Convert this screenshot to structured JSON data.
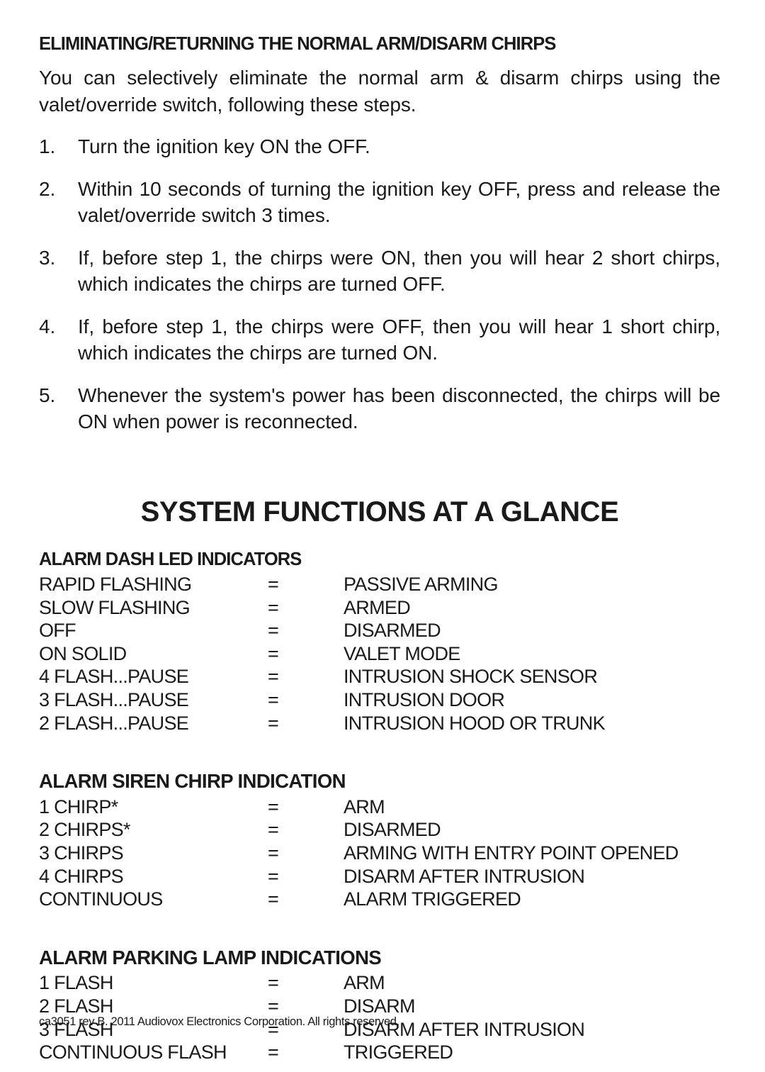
{
  "section1": {
    "heading": "ELIMINATING/RETURNING THE NORMAL ARM/DISARM CHIRPS",
    "intro": "You can selectively eliminate the normal arm & disarm chirps using the valet/override switch, following these steps.",
    "steps": [
      {
        "num": "1.",
        "text": "Turn the ignition key ON the OFF."
      },
      {
        "num": "2.",
        "text": "Within 10 seconds of turning the ignition key OFF, press and release the valet/override switch 3 times."
      },
      {
        "num": "3.",
        "text": "If, before step 1, the chirps were ON, then you will hear 2 short chirps, which indicates the chirps are turned OFF."
      },
      {
        "num": "4.",
        "text": "If, before step 1, the chirps were OFF, then you will hear 1 short chirp, which indicates the chirps are turned ON."
      },
      {
        "num": "5.",
        "text": "Whenever the system's power has been disconnected, the chirps will be ON when power is reconnected."
      }
    ]
  },
  "glance": {
    "title": "SYSTEM FUNCTIONS AT A GLANCE",
    "tables": [
      {
        "heading": "ALARM DASH LED INDICATORS",
        "rows": [
          {
            "label": "RAPID FLASHING",
            "eq": "=",
            "value": "PASSIVE ARMING"
          },
          {
            "label": "SLOW FLASHING",
            "eq": "=",
            "value": "ARMED"
          },
          {
            "label": "OFF",
            "eq": "=",
            "value": "DISARMED"
          },
          {
            "label": "ON SOLID",
            "eq": "=",
            "value": "VALET MODE"
          },
          {
            "label": "4 FLASH...PAUSE",
            "eq": "=",
            "value": "INTRUSION SHOCK SENSOR"
          },
          {
            "label": "3 FLASH...PAUSE",
            "eq": "=",
            "value": "INTRUSION DOOR"
          },
          {
            "label": "2 FLASH...PAUSE",
            "eq": "=",
            "value": "INTRUSION HOOD OR TRUNK"
          }
        ]
      },
      {
        "heading": "ALARM SIREN CHIRP INDICATION",
        "rows": [
          {
            "label": "1 CHIRP*",
            "eq": "=",
            "value": "ARM"
          },
          {
            "label": "2 CHIRPS*",
            "eq": "=",
            "value": "DISARMED"
          },
          {
            "label": "3 CHIRPS",
            "eq": "=",
            "value": "ARMING WITH ENTRY POINT OPENED"
          },
          {
            "label": "4 CHIRPS",
            "eq": "=",
            "value": "DISARM AFTER INTRUSION"
          },
          {
            "label": "CONTINUOUS",
            "eq": "=",
            "value": "ALARM TRIGGERED"
          }
        ]
      },
      {
        "heading": "ALARM PARKING LAMP INDICATIONS",
        "rows": [
          {
            "label": "1 FLASH",
            "eq": "=",
            "value": "ARM"
          },
          {
            "label": "2 FLASH",
            "eq": "=",
            "value": "DISARM"
          },
          {
            "label": "3 FLASH",
            "eq": "=",
            "value": "DISARM AFTER INTRUSION"
          },
          {
            "label": "CONTINUOUS FLASH",
            "eq": "=",
            "value": "TRIGGERED"
          }
        ]
      }
    ]
  },
  "footer": {
    "text": "ca3051 rev B. 2011 Audiovox Electronics Corporation. All rights reserved."
  }
}
